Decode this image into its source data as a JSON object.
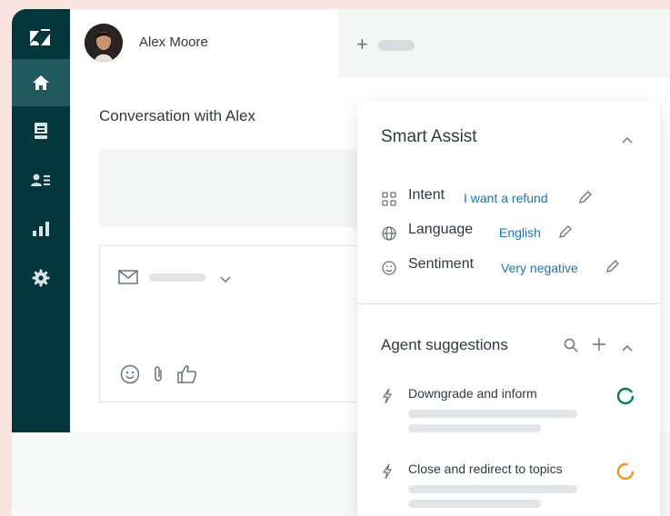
{
  "app": {
    "user_name": "Alex Moore",
    "conversation_title": "Conversation with Alex",
    "tab_add": "+"
  },
  "sidebar": {
    "items": [
      {
        "icon": "zendesk-logo-icon",
        "active": false
      },
      {
        "icon": "home-icon",
        "active": true
      },
      {
        "icon": "views-icon",
        "active": false
      },
      {
        "icon": "customers-icon",
        "active": false
      },
      {
        "icon": "reporting-icon",
        "active": false
      },
      {
        "icon": "settings-icon",
        "active": false
      }
    ]
  },
  "composer": {
    "channel_icon": "mail-icon",
    "tools": [
      "emoji-icon",
      "attachment-icon",
      "thumbs-up-icon"
    ]
  },
  "smart_assist": {
    "title": "Smart Assist",
    "rows": [
      {
        "icon": "intent-grid-icon",
        "label": "Intent",
        "value": "I want a refund"
      },
      {
        "icon": "globe-icon",
        "label": "Language",
        "value": "English"
      },
      {
        "icon": "smiley-icon",
        "label": "Sentiment",
        "value": "Very negative"
      }
    ]
  },
  "agent_suggestions": {
    "title": "Agent suggestions",
    "items": [
      {
        "label": "Downgrade and inform",
        "status_color": "#038153"
      },
      {
        "label": "Close and redirect to topics",
        "status_color": "#ed961c"
      }
    ]
  },
  "colors": {
    "sidebar": "#03363d",
    "sidebar_active": "#22595e",
    "link": "#1f73b7",
    "background": "#f8e4df"
  }
}
